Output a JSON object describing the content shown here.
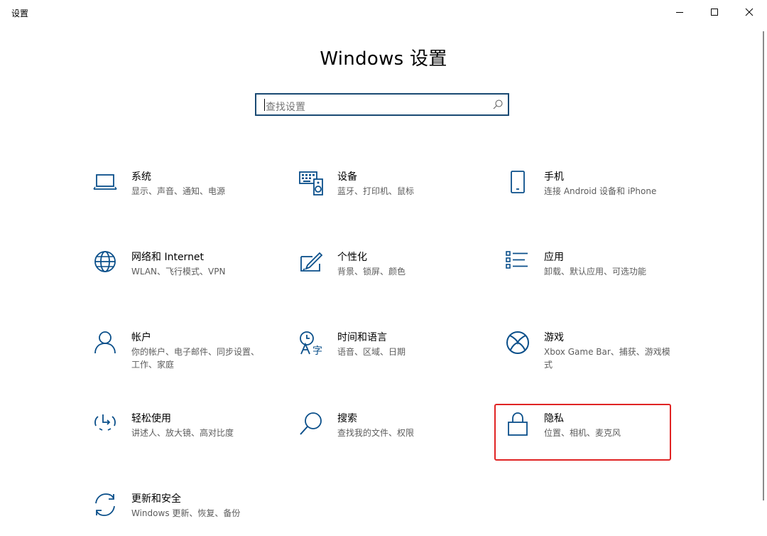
{
  "window": {
    "app_title": "设置",
    "minimize_icon": "minimize-icon",
    "maximize_icon": "maximize-icon",
    "close_icon": "close-icon"
  },
  "header": {
    "title": "Windows 设置"
  },
  "search": {
    "placeholder": "查找设置",
    "icon": "search-icon"
  },
  "tiles": [
    {
      "title": "系统",
      "desc": "显示、声音、通知、电源",
      "icon": "laptop-icon"
    },
    {
      "title": "设备",
      "desc": "蓝牙、打印机、鼠标",
      "icon": "keyboard-speaker-icon"
    },
    {
      "title": "手机",
      "desc": "连接 Android 设备和 iPhone",
      "icon": "phone-icon"
    },
    {
      "title": "网络和 Internet",
      "desc": "WLAN、飞行模式、VPN",
      "icon": "globe-icon"
    },
    {
      "title": "个性化",
      "desc": "背景、锁屏、颜色",
      "icon": "paint-icon"
    },
    {
      "title": "应用",
      "desc": "卸载、默认应用、可选功能",
      "icon": "apps-list-icon"
    },
    {
      "title": "帐户",
      "desc": "你的帐户、电子邮件、同步设置、工作、家庭",
      "icon": "person-icon"
    },
    {
      "title": "时间和语言",
      "desc": "语音、区域、日期",
      "icon": "time-language-icon"
    },
    {
      "title": "游戏",
      "desc": "Xbox Game Bar、捕获、游戏模式",
      "icon": "xbox-icon"
    },
    {
      "title": "轻松使用",
      "desc": "讲述人、放大镜、高对比度",
      "icon": "ease-of-access-icon"
    },
    {
      "title": "搜索",
      "desc": "查找我的文件、权限",
      "icon": "search-icon"
    },
    {
      "title": "隐私",
      "desc": "位置、相机、麦克风",
      "icon": "lock-icon"
    },
    {
      "title": "更新和安全",
      "desc": "Windows 更新、恢复、备份",
      "icon": "update-sync-icon"
    }
  ],
  "colors": {
    "accent": "#0a4f8a",
    "search_border": "#1a4a73",
    "highlight": "#e02424",
    "description_text": "#5c5c5c"
  }
}
